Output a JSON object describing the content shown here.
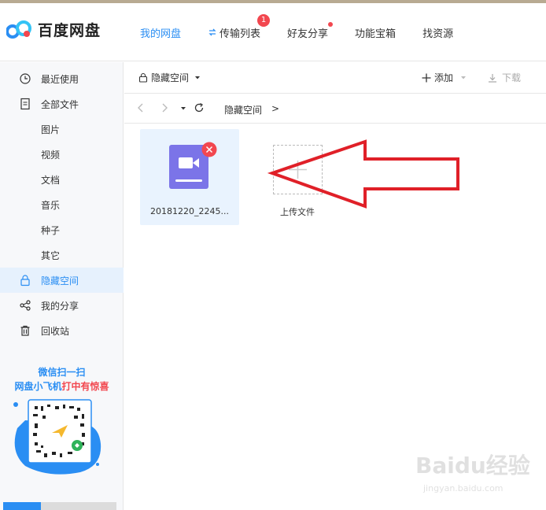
{
  "app": {
    "name": "百度网盘"
  },
  "nav": {
    "tabs": [
      {
        "label": "我的网盘"
      },
      {
        "label": "传输列表",
        "badge": "1"
      },
      {
        "label": "好友分享"
      },
      {
        "label": "功能宝箱"
      },
      {
        "label": "找资源"
      }
    ]
  },
  "sidebar": {
    "items": [
      {
        "label": "最近使用",
        "icon": "clock-icon"
      },
      {
        "label": "全部文件",
        "icon": "file-icon"
      },
      {
        "label": "图片"
      },
      {
        "label": "视频"
      },
      {
        "label": "文档"
      },
      {
        "label": "音乐"
      },
      {
        "label": "种子"
      },
      {
        "label": "其它"
      },
      {
        "label": "隐藏空间",
        "icon": "lock-icon"
      },
      {
        "label": "我的分享",
        "icon": "share-icon"
      },
      {
        "label": "回收站",
        "icon": "trash-icon"
      }
    ],
    "promo": {
      "line1": "微信扫一扫",
      "line2_a": "网盘小飞机",
      "line2_b": "打中有惊喜"
    }
  },
  "toolbar": {
    "folder": "隐藏空间",
    "add": "添加",
    "download": "下载"
  },
  "path": {
    "current": "隐藏空间",
    "sep": ">"
  },
  "files": [
    {
      "name": "20181220_2245...",
      "type": "video"
    }
  ],
  "upload": {
    "label": "上传文件"
  },
  "watermark": {
    "brand": "Baidu经验",
    "url": "jingyan.baidu.com"
  },
  "colors": {
    "accent": "#2a8ef3",
    "badge": "#f2474f",
    "video": "#7b74e8",
    "arrow": "#e02028"
  }
}
